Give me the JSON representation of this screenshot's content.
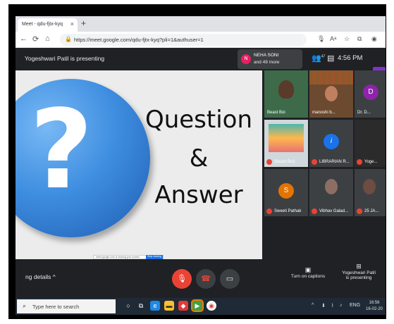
{
  "browser": {
    "tab_title": "Meet - qdu-fjtx-kyq",
    "tab_close": "×",
    "new_tab": "+",
    "url": "https://meet.google.com/qdu-fjtx-kyq?pli=1&authuser=1"
  },
  "meet_header": {
    "presenting_title": "Yogeshwari Patil is presenting",
    "participant_chip_initial": "N",
    "participant_chip_name": "NEHA SONI",
    "participant_chip_sub": "and 49 more",
    "people_count": "47",
    "time": "4:56 PM"
  },
  "slide": {
    "line1": "Question",
    "line2": "&",
    "line3": "Answer",
    "share_notice": "meet.google.com is sharing your screen",
    "stop_sharing": "Stop sharing"
  },
  "participants": [
    {
      "name": "Beast Boi",
      "kind": "video"
    },
    {
      "name": "manoshi b...",
      "kind": "video"
    },
    {
      "name": "Dr. D...",
      "kind": "letter",
      "letter": "D",
      "color": "#8e24aa"
    },
    {
      "name": "(Beast Boi)",
      "kind": "video",
      "muted": true
    },
    {
      "name": "LIBRARIAN R...",
      "kind": "logo",
      "muted": true
    },
    {
      "name": "Yoge...",
      "kind": "video",
      "muted": true
    },
    {
      "name": "Sweeti Pathak",
      "kind": "letter",
      "letter": "S",
      "color": "#e37400",
      "muted": true
    },
    {
      "name": "Vibhav Galad...",
      "kind": "video",
      "muted": true
    },
    {
      "name": "25 JA...",
      "kind": "video",
      "muted": true
    }
  ],
  "controls": {
    "meeting_details": "ng details",
    "captions_label1": "Turn on captions",
    "present_label1": "Yogeshwari Patil",
    "present_label2": "is presenting"
  },
  "taskbar": {
    "search_placeholder": "Type here to search",
    "lang": "ENG",
    "clock_time": "16:56",
    "clock_date": "16-02-20"
  },
  "colors": {
    "meet_bg": "#202124",
    "mic_off_red": "#ea4335",
    "accent_blue": "#1a73e8"
  }
}
